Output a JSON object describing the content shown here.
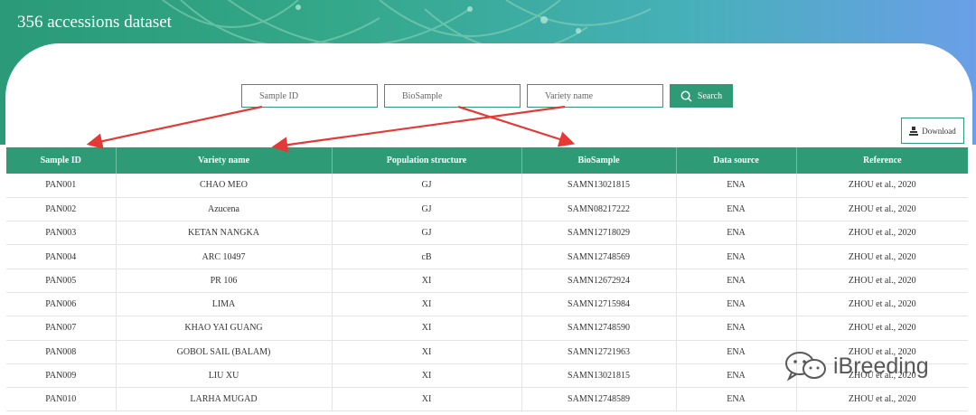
{
  "header": {
    "title": "356 accessions dataset"
  },
  "search": {
    "sample_id_placeholder": "Sample ID",
    "biosample_placeholder": "BioSample",
    "variety_placeholder": "Variety name",
    "button_label": "Search"
  },
  "download": {
    "label": "Download"
  },
  "table": {
    "columns": [
      "Sample ID",
      "Variety name",
      "Population structure",
      "BioSample",
      "Data source",
      "Reference"
    ],
    "rows": [
      [
        "PAN001",
        "CHAO MEO",
        "GJ",
        "SAMN13021815",
        "ENA",
        "ZHOU et al., 2020"
      ],
      [
        "PAN002",
        "Azucena",
        "GJ",
        "SAMN08217222",
        "ENA",
        "ZHOU et al., 2020"
      ],
      [
        "PAN003",
        "KETAN NANGKA",
        "GJ",
        "SAMN12718029",
        "ENA",
        "ZHOU et al., 2020"
      ],
      [
        "PAN004",
        "ARC 10497",
        "cB",
        "SAMN12748569",
        "ENA",
        "ZHOU et al., 2020"
      ],
      [
        "PAN005",
        "PR 106",
        "XI",
        "SAMN12672924",
        "ENA",
        "ZHOU et al., 2020"
      ],
      [
        "PAN006",
        "LIMA",
        "XI",
        "SAMN12715984",
        "ENA",
        "ZHOU et al., 2020"
      ],
      [
        "PAN007",
        "KHAO YAI GUANG",
        "XI",
        "SAMN12748590",
        "ENA",
        "ZHOU et al., 2020"
      ],
      [
        "PAN008",
        "GOBOL SAIL (BALAM)",
        "XI",
        "SAMN12721963",
        "ENA",
        "ZHOU et al., 2020"
      ],
      [
        "PAN009",
        "LIU XU",
        "XI",
        "SAMN13021815",
        "ENA",
        "ZHOU et al., 2020"
      ],
      [
        "PAN010",
        "LARHA MUGAD",
        "XI",
        "SAMN12748589",
        "ENA",
        "ZHOU et al., 2020"
      ]
    ]
  },
  "watermark": {
    "text": "iBreeding"
  },
  "colors": {
    "accent": "#2e9a76",
    "arrow": "#e53935"
  }
}
